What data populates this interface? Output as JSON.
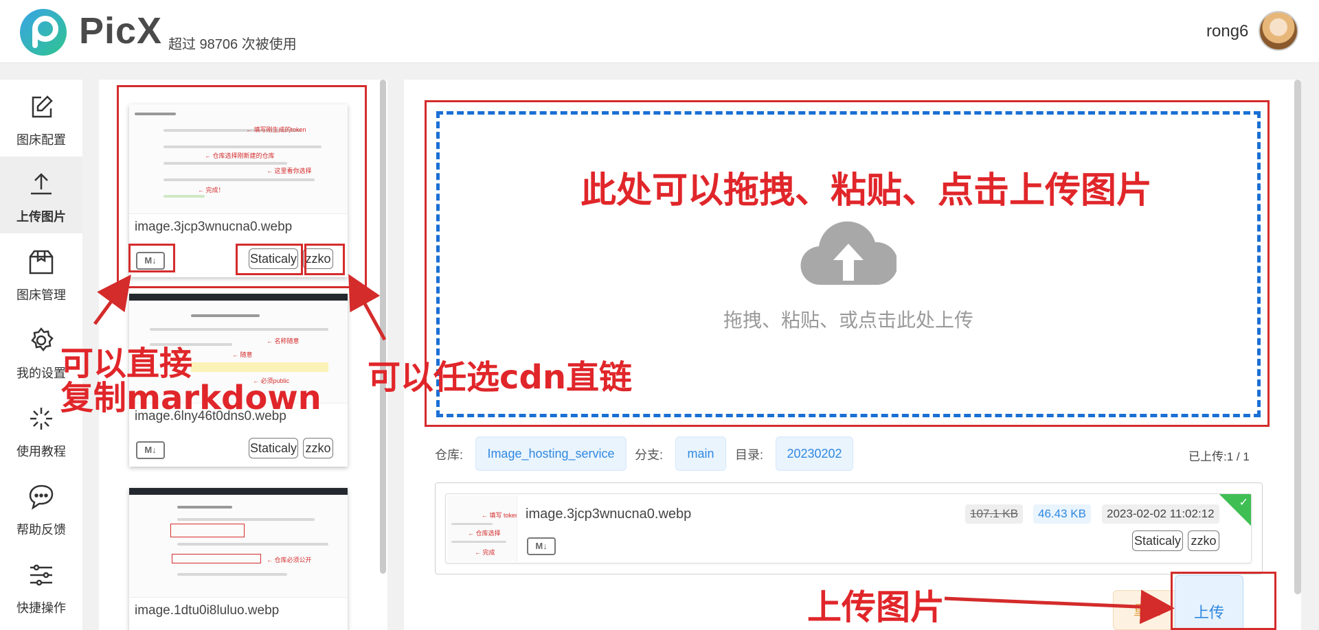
{
  "header": {
    "brand": "PicX",
    "tagline": "超过 98706 次被使用",
    "username": "rong6"
  },
  "nav": {
    "items": [
      {
        "label": "图床配置",
        "icon": "edit-icon"
      },
      {
        "label": "上传图片",
        "icon": "upload-icon",
        "active": true
      },
      {
        "label": "图床管理",
        "icon": "box-icon"
      },
      {
        "label": "我的设置",
        "icon": "gear-icon"
      },
      {
        "label": "使用教程",
        "icon": "sparkle-icon"
      },
      {
        "label": "帮助反馈",
        "icon": "chat-icon"
      },
      {
        "label": "快捷操作",
        "icon": "sliders-icon"
      }
    ]
  },
  "thumbnails": [
    {
      "name": "image.3jcp3wnucna0.webp",
      "md": "M↓",
      "cdn1": "Staticaly",
      "cdn2": "zzko"
    },
    {
      "name": "image.6lny46t0dns0.webp",
      "md": "M↓",
      "cdn1": "Staticaly",
      "cdn2": "zzko"
    },
    {
      "name": "image.1dtu0i8luluo.webp"
    }
  ],
  "upload": {
    "hint": "拖拽、粘贴、或点击此处上传",
    "repo_label": "仓库:",
    "repo": "Image_hosting_service",
    "branch_label": "分支:",
    "branch": "main",
    "dir_label": "目录:",
    "dir": "20230202",
    "uploaded": "已上传:1 / 1"
  },
  "upload_item": {
    "name": "image.3jcp3wnucna0.webp",
    "size_before": "107.1 KB",
    "size_after": "46.43 KB",
    "time": "2023-02-02 11:02:12",
    "md": "M↓",
    "cdn1": "Staticaly",
    "cdn2": "zzko"
  },
  "buttons": {
    "reset": "重置",
    "upload": "上传"
  },
  "annotations": {
    "drop_area": "此处可以拖拽、粘贴、点击上传图片",
    "copy_md_line1": "可以直接",
    "copy_md_line2": "复制markdown",
    "cdn_pick": "可以任选cdn直链",
    "upload_btn": "上传图片"
  },
  "colors": {
    "accent": "#2f88e0",
    "annotation": "#d42b2b",
    "dashed_border": "#1a6fd4",
    "success": "#3fbf53"
  }
}
